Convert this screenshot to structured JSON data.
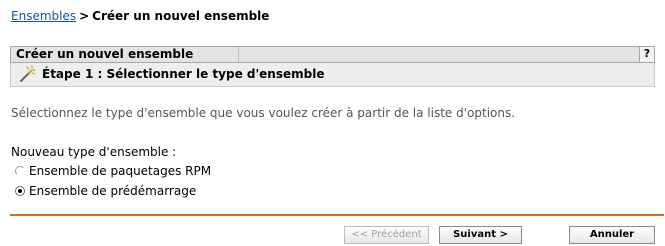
{
  "breadcrumb": {
    "link": "Ensembles",
    "separator": ">",
    "current": "Créer un nouvel ensemble"
  },
  "panel": {
    "title": "Créer un nouvel ensemble",
    "help_label": "?"
  },
  "step": {
    "icon": "wand-icon",
    "title": "Étape 1 : Sélectionner le type d'ensemble"
  },
  "instructions": "Sélectionnez le type d'ensemble que vous voulez créer à partir de la liste d'options.",
  "bundle_type": {
    "label": "Nouveau type d'ensemble :",
    "options": [
      {
        "label": "Ensemble de paquetages RPM",
        "selected": false
      },
      {
        "label": "Ensemble de prédémarrage",
        "selected": true
      }
    ]
  },
  "footer": {
    "accent_color": "#e06a1a",
    "previous_label": "<< Précédent",
    "next_label": "Suivant >",
    "cancel_label": "Annuler"
  }
}
